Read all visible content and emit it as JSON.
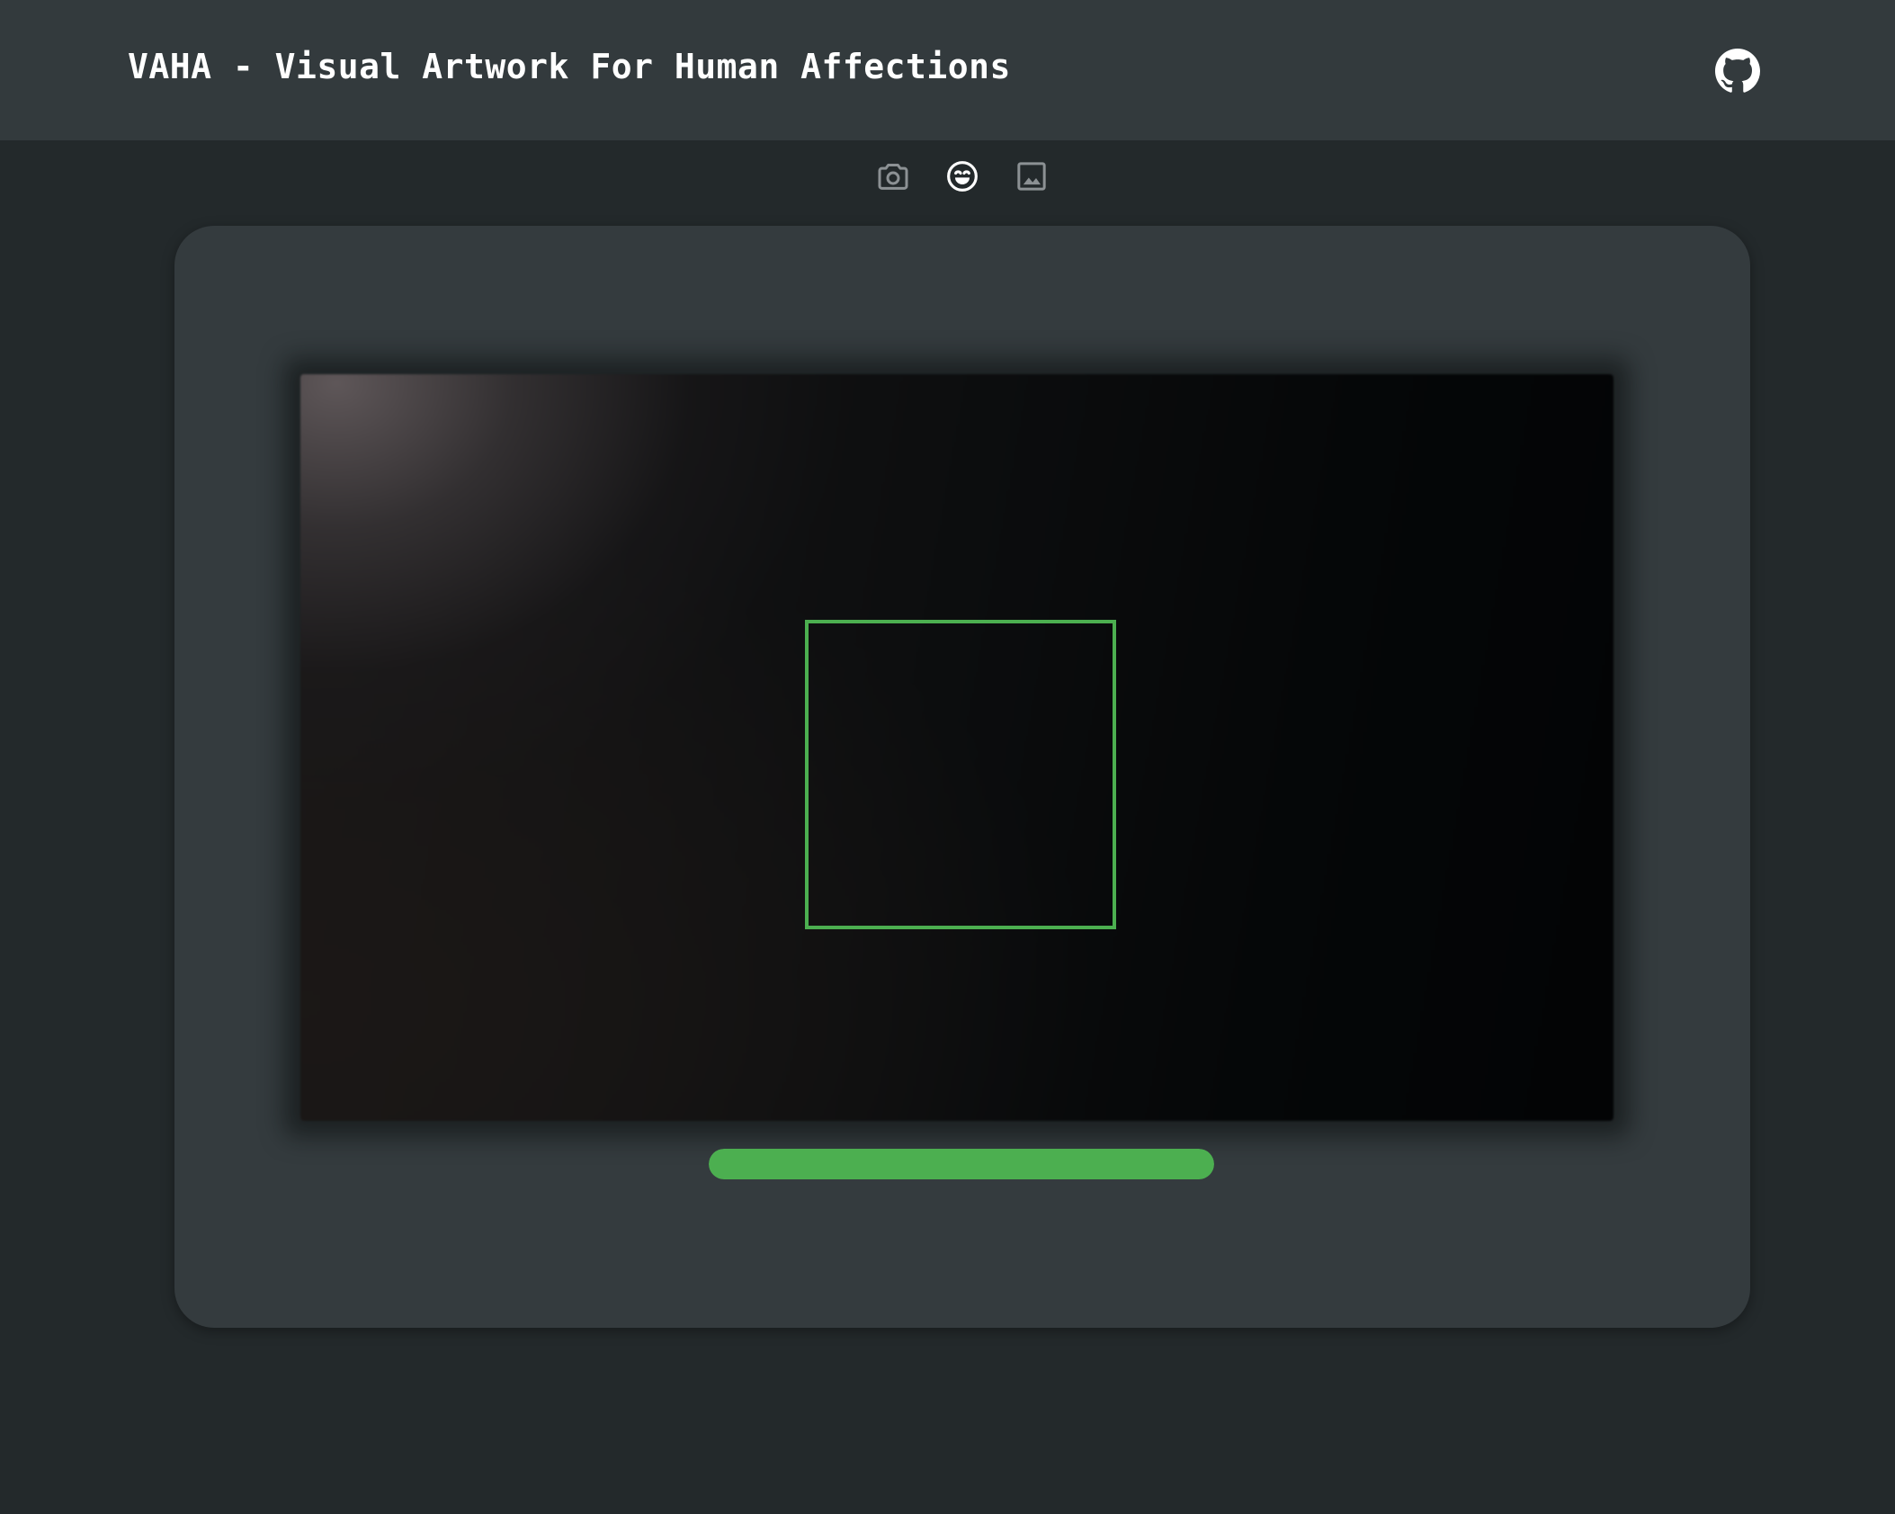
{
  "header": {
    "title": "VAHA - Visual Artwork For Human Affections",
    "github_icon": "github-icon"
  },
  "modes": [
    {
      "icon": "camera-icon",
      "active": false
    },
    {
      "icon": "face-smile-icon",
      "active": true
    },
    {
      "icon": "image-icon",
      "active": false
    }
  ],
  "detection": {
    "box_color": "#4caf50"
  },
  "progress": {
    "value": 1.0,
    "color": "#4caf50"
  },
  "colors": {
    "background": "#23292b",
    "header": "#333a3d",
    "card": "#343b3e",
    "accent": "#4caf50",
    "icon_inactive": "#8c9194",
    "icon_active": "#ffffff"
  }
}
